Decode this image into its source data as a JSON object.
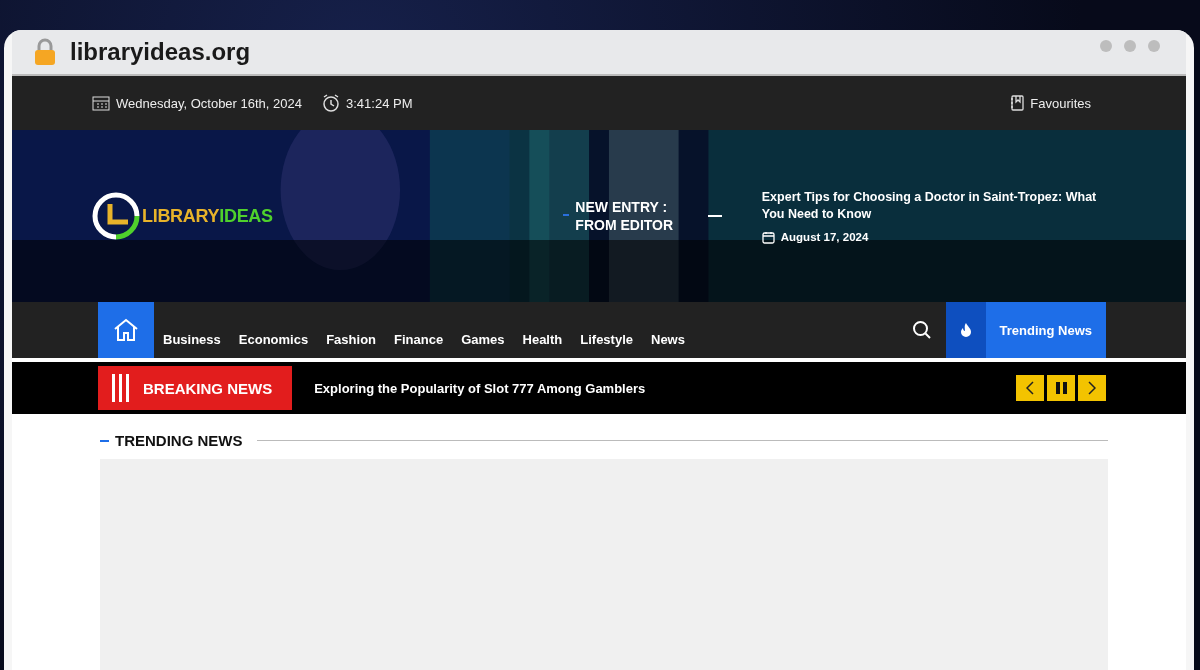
{
  "browser": {
    "url": "libraryideas.org"
  },
  "top_bar": {
    "date": "Wednesday, October 16th, 2024",
    "time": "3:41:24 PM",
    "favourites": "Favourites"
  },
  "logo": {
    "parts": [
      {
        "text": "LIBRARY",
        "color": "#e8b32a"
      },
      {
        "text": "IDEAS",
        "color": "#4fd12c"
      }
    ]
  },
  "new_entry": {
    "label": "NEW ENTRY : FROM EDITOR",
    "headline": "Expert Tips for Choosing a Doctor in Saint-Tropez: What You Need to Know",
    "date": "August 17, 2024"
  },
  "nav": {
    "home_selected": true,
    "items": [
      {
        "label": "Business",
        "selected": false
      },
      {
        "label": "Economics",
        "selected": false
      },
      {
        "label": "Fashion",
        "selected": false
      },
      {
        "label": "Finance",
        "selected": false
      },
      {
        "label": "Games",
        "selected": false
      },
      {
        "label": "Health",
        "selected": false
      },
      {
        "label": "Lifestyle",
        "selected": false
      },
      {
        "label": "News",
        "selected": false
      }
    ],
    "trending_button": "Trending News"
  },
  "breaking": {
    "label": "BREAKING NEWS",
    "headline": "Exploring the Popularity of Slot 777 Among Gamblers",
    "paused": false
  },
  "section": {
    "title": "TRENDING NEWS"
  }
}
